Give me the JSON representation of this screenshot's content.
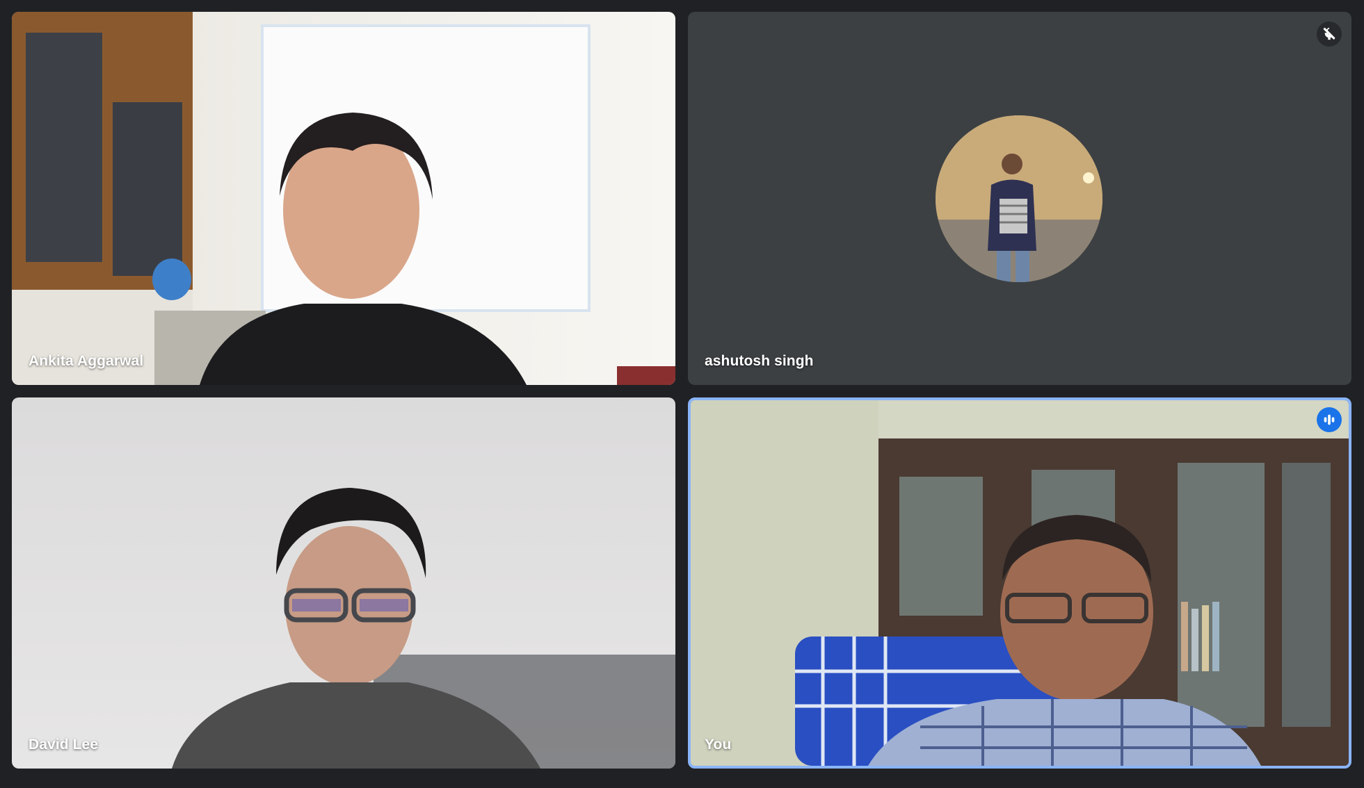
{
  "app": {
    "background_color": "#202124",
    "active_speaker_color": "#8ab4f8",
    "speaking_badge_color": "#1a73e8"
  },
  "participants": [
    {
      "name": "Ankita Aggarwal",
      "state": "video-on"
    },
    {
      "name": "ashutosh singh",
      "state": "video-off",
      "status_icon": "mic-off-icon"
    },
    {
      "name": "David Lee",
      "state": "video-on"
    },
    {
      "name": "You",
      "state": "video-on",
      "status_icon": "speaking-icon",
      "active_speaker": true
    }
  ]
}
